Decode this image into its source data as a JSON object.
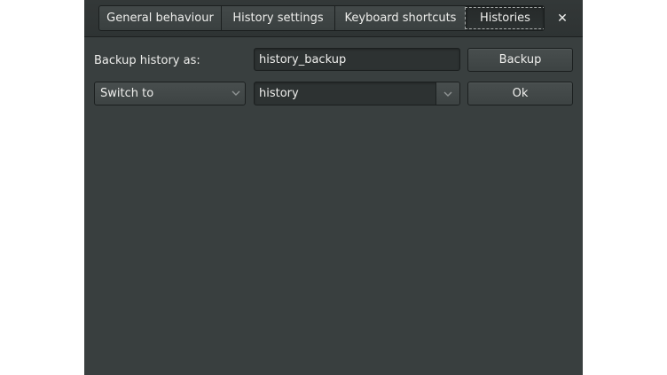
{
  "tabs": [
    {
      "label": "General behaviour"
    },
    {
      "label": "History settings"
    },
    {
      "label": "Keyboard shortcuts"
    },
    {
      "label": "Histories"
    }
  ],
  "active_tab": "Histories",
  "close_glyph": "✕",
  "backup": {
    "label": "Backup history as:",
    "value": "history_backup",
    "button_label": "Backup"
  },
  "switch": {
    "action_selected": "Switch to",
    "history_selected": "history",
    "button_label": "Ok"
  },
  "colors": {
    "window_bg": "#393f3f",
    "text": "#eeeeec"
  },
  "icons": {
    "close": "close-icon",
    "dropdown": "chevron-down-icon"
  }
}
